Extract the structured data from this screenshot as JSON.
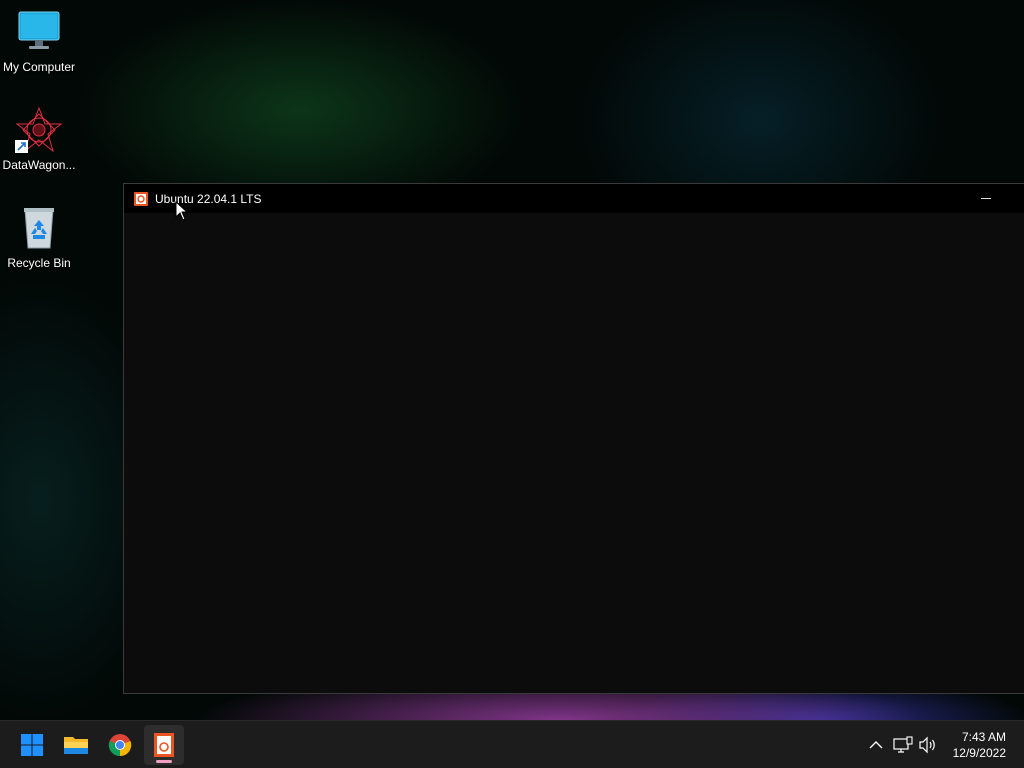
{
  "desktop": {
    "icons": [
      {
        "label": "My Computer",
        "icon": "monitor-icon"
      },
      {
        "label": "DataWagon...",
        "icon": "datawagon-icon"
      },
      {
        "label": "Recycle Bin",
        "icon": "recycle-bin-icon"
      }
    ]
  },
  "window": {
    "title": "Ubuntu 22.04.1 LTS",
    "icon": "ubuntu-icon"
  },
  "taskbar": {
    "pinned": [
      {
        "name": "start",
        "icon": "windows-logo-icon"
      },
      {
        "name": "file-explorer",
        "icon": "folder-icon"
      },
      {
        "name": "chrome",
        "icon": "chrome-icon"
      },
      {
        "name": "ubuntu",
        "icon": "ubuntu-icon",
        "active": true
      }
    ],
    "tray": {
      "time": "7:43 AM",
      "date": "12/9/2022"
    }
  },
  "colors": {
    "accent_start": "#1e90ff",
    "ubuntu_orange": "#e95420",
    "active_indicator": "#f0a0c0"
  }
}
